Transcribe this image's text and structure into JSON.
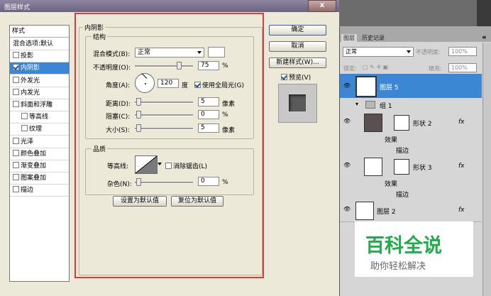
{
  "dialog": {
    "title": "图层样式",
    "close": "x",
    "styles_header": "样式",
    "styles": [
      {
        "label": "混合选项:默认",
        "checkbox": false,
        "checked": false,
        "indent": false,
        "selected": false
      },
      {
        "label": "投影",
        "checkbox": true,
        "checked": false,
        "indent": false,
        "selected": false
      },
      {
        "label": "内阴影",
        "checkbox": true,
        "checked": true,
        "indent": false,
        "selected": true
      },
      {
        "label": "外发光",
        "checkbox": true,
        "checked": false,
        "indent": false,
        "selected": false
      },
      {
        "label": "内发光",
        "checkbox": true,
        "checked": false,
        "indent": false,
        "selected": false
      },
      {
        "label": "斜面和浮雕",
        "checkbox": true,
        "checked": false,
        "indent": false,
        "selected": false
      },
      {
        "label": "等高线",
        "checkbox": true,
        "checked": false,
        "indent": true,
        "selected": false
      },
      {
        "label": "纹理",
        "checkbox": true,
        "checked": false,
        "indent": true,
        "selected": false
      },
      {
        "label": "光泽",
        "checkbox": true,
        "checked": false,
        "indent": false,
        "selected": false
      },
      {
        "label": "颜色叠加",
        "checkbox": true,
        "checked": false,
        "indent": false,
        "selected": false
      },
      {
        "label": "渐变叠加",
        "checkbox": true,
        "checked": false,
        "indent": false,
        "selected": false
      },
      {
        "label": "图案叠加",
        "checkbox": true,
        "checked": false,
        "indent": false,
        "selected": false
      },
      {
        "label": "描边",
        "checkbox": true,
        "checked": false,
        "indent": false,
        "selected": false
      }
    ],
    "section_title": "内阴影",
    "structure_title": "结构",
    "blend_mode_label": "混合模式(B):",
    "blend_mode_value": "正常",
    "opacity_label": "不透明度(O):",
    "opacity_value": "75",
    "opacity_unit": "%",
    "angle_label": "角度(A):",
    "angle_value": "120",
    "angle_unit": "度",
    "global_light_label": "使用全局光(G)",
    "distance_label": "距离(D):",
    "distance_value": "5",
    "distance_unit": "像素",
    "choke_label": "阻塞(C):",
    "choke_value": "0",
    "choke_unit": "%",
    "size_label": "大小(S):",
    "size_value": "5",
    "size_unit": "像素",
    "quality_title": "品质",
    "contour_label": "等高线:",
    "antialias_label": "消除锯齿(L)",
    "noise_label": "杂色(N):",
    "noise_value": "0",
    "noise_unit": "%",
    "set_default": "设置为默认值",
    "reset_default": "复位为默认值",
    "ok": "确定",
    "cancel": "取消",
    "new_style": "新建样式(W)...",
    "preview_label": "预览(V)"
  },
  "layers_panel": {
    "tab_layers": "图层",
    "tab_history": "历史记录",
    "blend_mode": "正常",
    "opacity_label": "不透明度:",
    "opacity_value": "100%",
    "lock_label": "锁定:",
    "fill_label": "填充:",
    "fill_value": "100%",
    "layers": [
      {
        "name": "图层 5",
        "selected": true
      },
      {
        "name": "组 1"
      },
      {
        "name": "形状 2",
        "fx": "fx"
      },
      {
        "name": "效果"
      },
      {
        "name": "描边"
      },
      {
        "name": "形状 3",
        "fx": "fx"
      },
      {
        "name": "效果"
      },
      {
        "name": "描边"
      },
      {
        "name": "图层 2",
        "fx": "fx"
      }
    ]
  },
  "watermark": {
    "title": "百科全说",
    "subtitle": "助你轻松解决"
  },
  "colors": {
    "selection": "#3c87d4",
    "highlight_frame": "#e03a3a",
    "watermark_text": "#1fae4a"
  }
}
